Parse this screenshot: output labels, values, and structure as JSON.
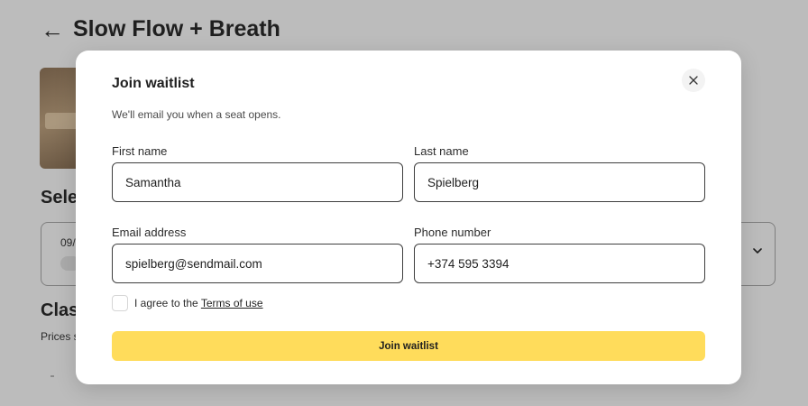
{
  "background": {
    "back_arrow": "←",
    "page_title": "Slow Flow + Breath",
    "section_title_partial": "Sele",
    "session_date_partial": "09/",
    "class_title_partial": "Clas",
    "price_text_partial": "Prices s"
  },
  "modal": {
    "title": "Join waitlist",
    "subtitle": "We'll email you when a seat opens.",
    "close_icon": "close-icon",
    "fields": {
      "first_name": {
        "label": "First name",
        "value": "Samantha"
      },
      "last_name": {
        "label": "Last name",
        "value": "Spielberg"
      },
      "email": {
        "label": "Email address",
        "value": "spielberg@sendmail.com"
      },
      "phone": {
        "label": "Phone number",
        "value": "+374 595 3394"
      }
    },
    "terms": {
      "prefix": "I agree to the ",
      "link_text": "Terms of use"
    },
    "submit_label": "Join waitlist"
  },
  "colors": {
    "accent": "#ffdc5b",
    "overlay": "#bcbcbc",
    "text": "#1f1f1f"
  }
}
